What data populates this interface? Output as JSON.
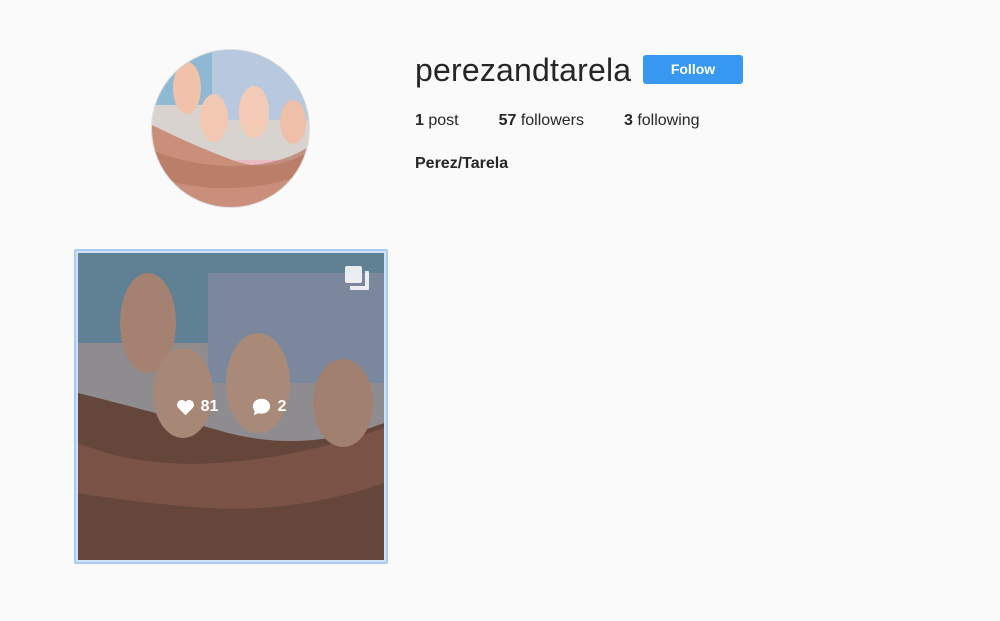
{
  "profile": {
    "username": "perezandtarela",
    "follow_label": "Follow",
    "full_name": "Perez/Tarela",
    "avatar_description": "baby feet held in hands"
  },
  "stats": {
    "posts_count": "1",
    "posts_label": " post",
    "followers_count": "57",
    "followers_label": " followers",
    "following_count": "3",
    "following_label": " following"
  },
  "posts": [
    {
      "likes": "81",
      "comments": "2",
      "is_multi": true,
      "icons": [
        "heart-icon",
        "comment-icon",
        "carousel-icon"
      ]
    }
  ],
  "colors": {
    "accent": "#3897f0",
    "background": "#fafafa",
    "selection_border": "#a8cbf5"
  }
}
